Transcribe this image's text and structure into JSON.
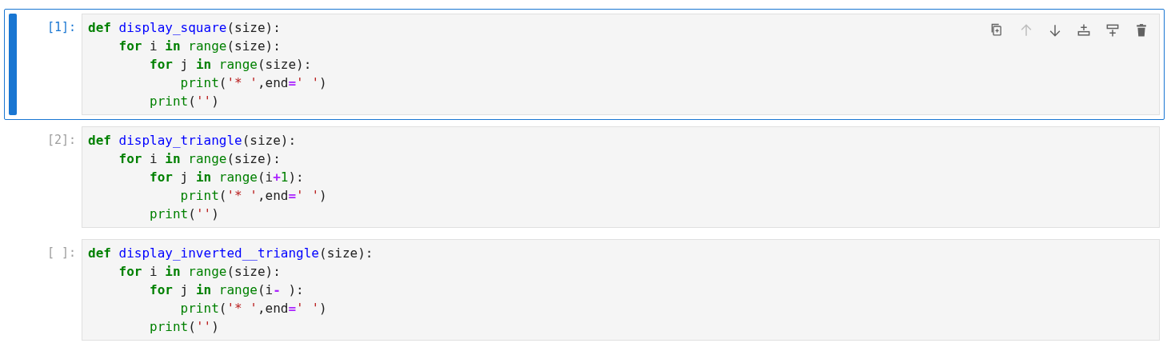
{
  "cells": [
    {
      "prompt": "[1]:",
      "selected": true,
      "toolbar": [
        {
          "kind": "duplicate",
          "disabled": false
        },
        {
          "kind": "move-up",
          "disabled": true
        },
        {
          "kind": "move-down",
          "disabled": false
        },
        {
          "kind": "insert-above",
          "disabled": false
        },
        {
          "kind": "insert-below",
          "disabled": false
        },
        {
          "kind": "delete",
          "disabled": false
        }
      ],
      "lines": [
        [
          {
            "kind": "keyword",
            "text": "def"
          },
          {
            "kind": "function",
            "text": " display_square"
          },
          {
            "kind": "plain",
            "text": "(size):"
          }
        ],
        [
          {
            "kind": "keyword",
            "text": "    for"
          },
          {
            "kind": "plain",
            "text": " i "
          },
          {
            "kind": "keyword",
            "text": "in"
          },
          {
            "kind": "builtin",
            "text": " range"
          },
          {
            "kind": "plain",
            "text": "(size):"
          }
        ],
        [
          {
            "kind": "keyword",
            "text": "        for"
          },
          {
            "kind": "plain",
            "text": " j "
          },
          {
            "kind": "keyword",
            "text": "in"
          },
          {
            "kind": "builtin",
            "text": " range"
          },
          {
            "kind": "plain",
            "text": "(size):"
          }
        ],
        [
          {
            "kind": "builtin",
            "text": "            print"
          },
          {
            "kind": "plain",
            "text": "("
          },
          {
            "kind": "string",
            "text": "'* '"
          },
          {
            "kind": "plain",
            "text": ",end"
          },
          {
            "kind": "operator",
            "text": "="
          },
          {
            "kind": "string",
            "text": "' '"
          },
          {
            "kind": "plain",
            "text": ")"
          }
        ],
        [
          {
            "kind": "builtin",
            "text": "        print"
          },
          {
            "kind": "plain",
            "text": "("
          },
          {
            "kind": "string",
            "text": "''"
          },
          {
            "kind": "plain",
            "text": ")"
          }
        ]
      ]
    },
    {
      "prompt": "[2]:",
      "selected": false,
      "lines": [
        [
          {
            "kind": "keyword",
            "text": "def"
          },
          {
            "kind": "function",
            "text": " display_triangle"
          },
          {
            "kind": "plain",
            "text": "(size):"
          }
        ],
        [
          {
            "kind": "keyword",
            "text": "    for"
          },
          {
            "kind": "plain",
            "text": " i "
          },
          {
            "kind": "keyword",
            "text": "in"
          },
          {
            "kind": "builtin",
            "text": " range"
          },
          {
            "kind": "plain",
            "text": "(size):"
          }
        ],
        [
          {
            "kind": "keyword",
            "text": "        for"
          },
          {
            "kind": "plain",
            "text": " j "
          },
          {
            "kind": "keyword",
            "text": "in"
          },
          {
            "kind": "builtin",
            "text": " range"
          },
          {
            "kind": "plain",
            "text": "(i"
          },
          {
            "kind": "operator",
            "text": "+"
          },
          {
            "kind": "number",
            "text": "1"
          },
          {
            "kind": "plain",
            "text": "):"
          }
        ],
        [
          {
            "kind": "builtin",
            "text": "            print"
          },
          {
            "kind": "plain",
            "text": "("
          },
          {
            "kind": "string",
            "text": "'* '"
          },
          {
            "kind": "plain",
            "text": ",end"
          },
          {
            "kind": "operator",
            "text": "="
          },
          {
            "kind": "string",
            "text": "' '"
          },
          {
            "kind": "plain",
            "text": ")"
          }
        ],
        [
          {
            "kind": "builtin",
            "text": "        print"
          },
          {
            "kind": "plain",
            "text": "("
          },
          {
            "kind": "string",
            "text": "''"
          },
          {
            "kind": "plain",
            "text": ")"
          }
        ]
      ]
    },
    {
      "prompt": "[ ]:",
      "selected": false,
      "lines": [
        [
          {
            "kind": "keyword",
            "text": "def"
          },
          {
            "kind": "function",
            "text": " display_inverted__triangle"
          },
          {
            "kind": "plain",
            "text": "(size):"
          }
        ],
        [
          {
            "kind": "keyword",
            "text": "    for"
          },
          {
            "kind": "plain",
            "text": " i "
          },
          {
            "kind": "keyword",
            "text": "in"
          },
          {
            "kind": "builtin",
            "text": " range"
          },
          {
            "kind": "plain",
            "text": "(size):"
          }
        ],
        [
          {
            "kind": "keyword",
            "text": "        for"
          },
          {
            "kind": "plain",
            "text": " j "
          },
          {
            "kind": "keyword",
            "text": "in"
          },
          {
            "kind": "builtin",
            "text": " range"
          },
          {
            "kind": "plain",
            "text": "(i"
          },
          {
            "kind": "operator",
            "text": "- "
          },
          {
            "kind": "plain",
            "text": "):"
          }
        ],
        [
          {
            "kind": "builtin",
            "text": "            print"
          },
          {
            "kind": "plain",
            "text": "("
          },
          {
            "kind": "string",
            "text": "'* '"
          },
          {
            "kind": "plain",
            "text": ",end"
          },
          {
            "kind": "operator",
            "text": "="
          },
          {
            "kind": "string",
            "text": "' '"
          },
          {
            "kind": "plain",
            "text": ")"
          }
        ],
        [
          {
            "kind": "builtin",
            "text": "        print"
          },
          {
            "kind": "plain",
            "text": "("
          },
          {
            "kind": "string",
            "text": "''"
          },
          {
            "kind": "plain",
            "text": ")"
          }
        ]
      ]
    }
  ]
}
